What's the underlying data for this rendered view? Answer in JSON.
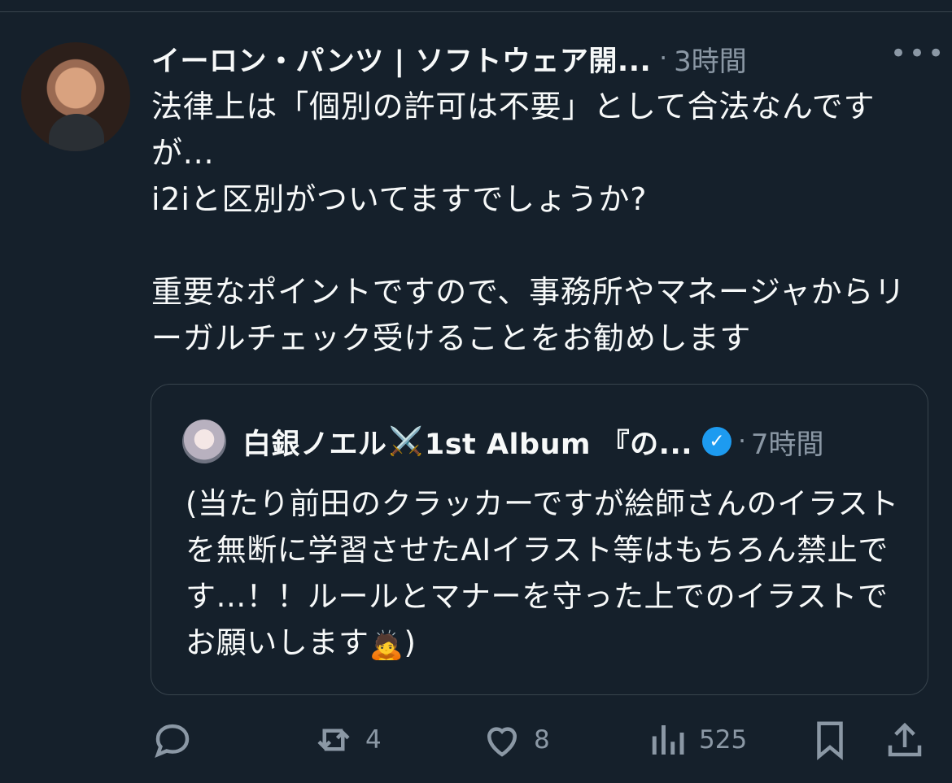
{
  "tweet": {
    "author": "イーロン・パンツ | ソフトウェア開...",
    "separator": "·",
    "time": "3時間",
    "more": "•••",
    "text": "法律上は「個別の許可は不要」として合法なんですが...\ni2iと区別がついてますでしょうか?\n\n重要なポイントですので、事務所やマネージャからリーガルチェック受けることをお勧めします"
  },
  "quote": {
    "author": "白銀ノエル",
    "icon": "⚔️",
    "album": "1st Album 『の...",
    "verified": "✓",
    "separator": "·",
    "time": "7時間",
    "text": "(当たり前田のクラッカーですが絵師さんのイラストを無断に学習させたAIイラスト等はもちろん禁止です...！！ルールとマナーを守った上でのイラストでお願いします",
    "emoji": "🙇",
    "closing": ")"
  },
  "actions": {
    "reply": "",
    "retweet": "4",
    "like": "8",
    "views": "525",
    "bookmark": "",
    "share": ""
  },
  "colors": {
    "background": "#15202b",
    "text": "#f7f9f9",
    "muted": "#8b98a5",
    "border": "#38444d",
    "verified": "#1d9bf0"
  }
}
